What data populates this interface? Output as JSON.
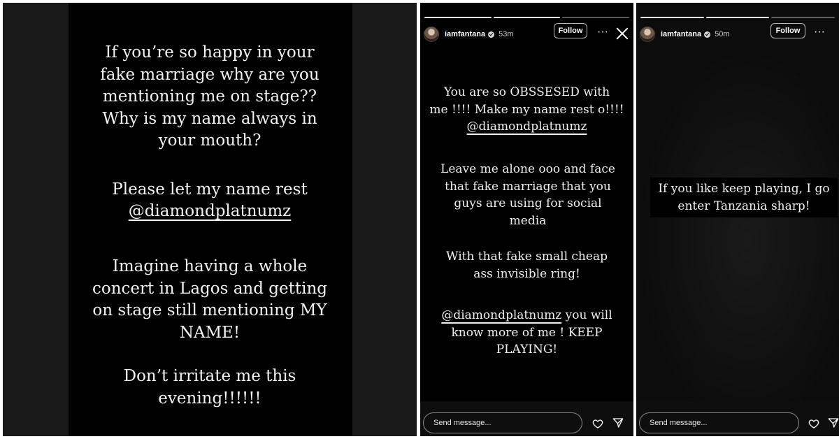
{
  "panel1": {
    "paragraphs": [
      "If you’re so happy in your fake marriage why are you mentioning me on stage?? Why is my name always in your mouth?",
      "Please let my name rest",
      "@diamondplatnumz",
      "Imagine having a whole concert in Lagos and getting on stage still mentioning MY NAME!",
      "Don’t irritate me this evening!!!!!!"
    ]
  },
  "story2": {
    "username": "iamfantana",
    "time": "53m",
    "follow_label": "Follow",
    "more_label": "···",
    "text": {
      "p1_line1": "You are so OBSSESED with",
      "p1_line2": "me !!!! Make my name rest o!!!!",
      "p1_mention": "@diamondplatnumz",
      "p2": "Leave me alone ooo and face that fake marriage that you guys are using for social media",
      "p3": "With that fake small cheap ass invisible ring!",
      "p4_mention": "@diamondplatnumz",
      "p4_rest": " you will know more of me ! KEEP PLAYING!"
    },
    "send_placeholder": "Send message..."
  },
  "story3": {
    "username": "iamfantana",
    "time": "50m",
    "follow_label": "Follow",
    "more_label": "···",
    "caption": "If you like keep playing, I go enter Tanzania sharp!",
    "send_placeholder": "Send message..."
  }
}
